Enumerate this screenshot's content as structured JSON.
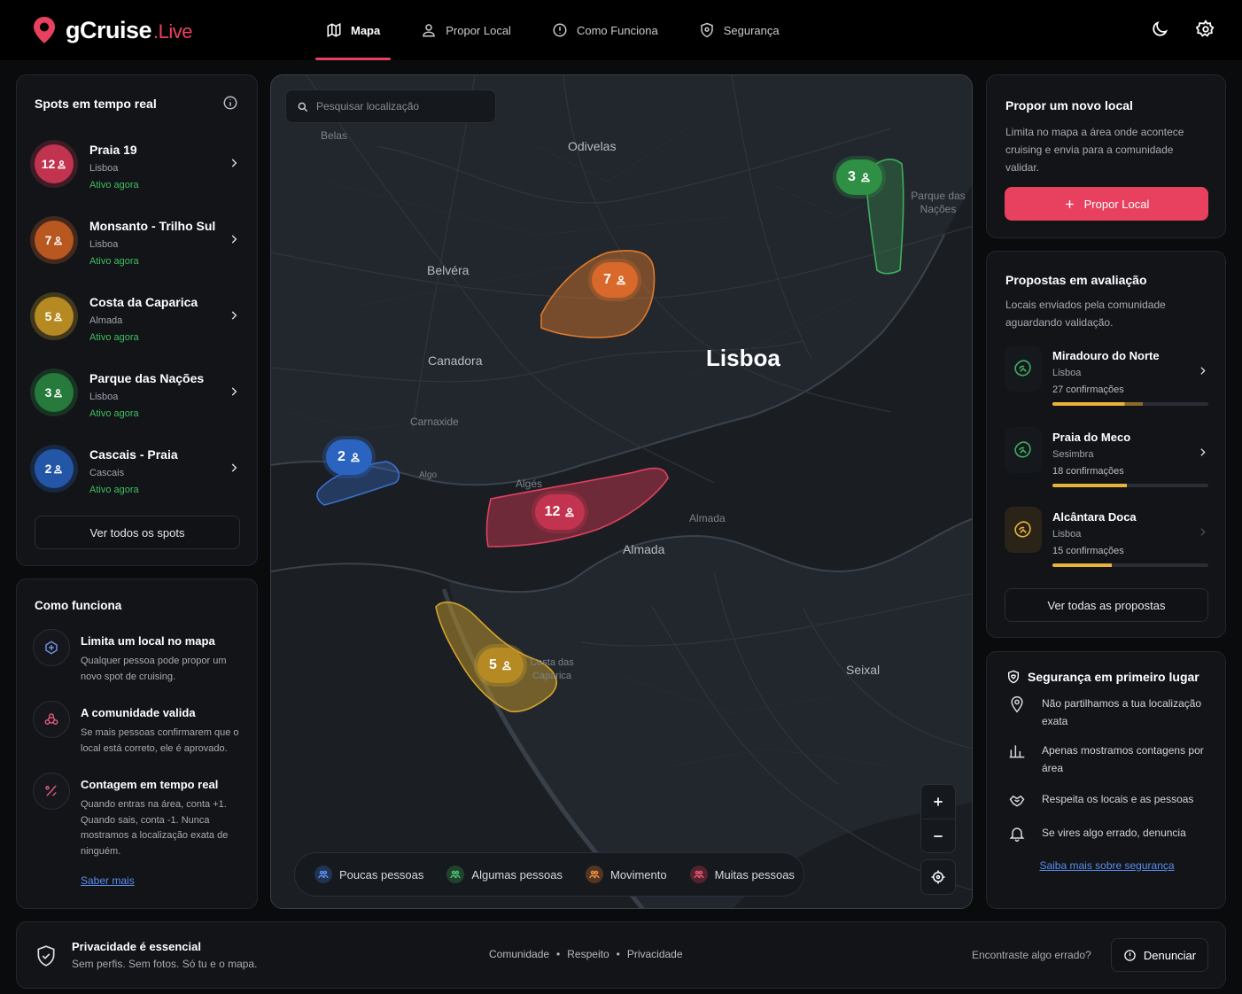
{
  "brand": {
    "name": "gCruise",
    "suffix": ".Live"
  },
  "nav": [
    {
      "label": "Mapa",
      "icon": "map-icon",
      "active": true
    },
    {
      "label": "Propor Local",
      "icon": "user-icon"
    },
    {
      "label": "Como Funciona",
      "icon": "info-icon"
    },
    {
      "label": "Segurança",
      "icon": "shield-icon"
    }
  ],
  "spots": {
    "title": "Spots em tempo real",
    "items": [
      {
        "count": "12",
        "name": "Praia 19",
        "city": "Lisboa",
        "status": "Ativo agora",
        "color": "#c2334f"
      },
      {
        "count": "7",
        "name": "Monsanto - Trilho Sul",
        "city": "Lisboa",
        "status": "Ativo agora",
        "color": "#d9692a"
      },
      {
        "count": "5",
        "name": "Costa da Caparica",
        "city": "Almada",
        "status": "Ativo agora",
        "color": "#d4a32c"
      },
      {
        "count": "3",
        "name": "Parque das Nações",
        "city": "Lisboa",
        "status": "Ativo agora",
        "color": "#2e8f45"
      },
      {
        "count": "2",
        "name": "Cascais - Praia",
        "city": "Cascais",
        "status": "Ativo agora",
        "color": "#2b64c0"
      }
    ],
    "view_all": "Ver todos os spots"
  },
  "how": {
    "title": "Como funciona",
    "steps": [
      {
        "title": "Limita um local no mapa",
        "desc": "Qualquer pessoa pode propor um novo spot de cruising."
      },
      {
        "title": "A comunidade valida",
        "desc": "Se mais pessoas confirmarem que o local está correto, ele é aprovado."
      },
      {
        "title": "Contagem em tempo real",
        "desc": "Quando entras na área, conta +1. Quando sais, conta -1. Nunca mostramos a localização exata de ninguém."
      }
    ],
    "link": "Saber mais"
  },
  "map": {
    "search_placeholder": "Pesquisar localização",
    "places": {
      "belas": "Belas",
      "odivelas": "Odivelas",
      "beloura": "Belvéra",
      "canadora": "Canadora",
      "carnaxide": "Carnaxide",
      "lisboa": "Lisboa",
      "parque": "Parque das Nações",
      "alges": "Algés",
      "almada_small": "Almada",
      "almada": "Almada",
      "seixal": "Seixal",
      "costa": "Costa das Caparica",
      "algo": "Algo"
    },
    "markers": {
      "m12": "12",
      "m7": "7",
      "m5": "5",
      "m3": "3",
      "m2": "2"
    },
    "legend": [
      {
        "label": "Poucas pessoas",
        "color": "#3b6fd1"
      },
      {
        "label": "Algumas pessoas",
        "color": "#3aa557"
      },
      {
        "label": "Movimento",
        "color": "#e07a2d"
      },
      {
        "label": "Muitas pessoas",
        "color": "#d83a55"
      }
    ]
  },
  "propose": {
    "title": "Propor um novo local",
    "desc": "Limita no mapa a área onde acontece cruising e envia para a comunidade validar.",
    "button": "Propor Local"
  },
  "proposals": {
    "title": "Propostas em avaliação",
    "desc": "Locais enviados pela comunidade aguardando validação.",
    "items": [
      {
        "name": "Miradouro do Norte",
        "city": "Lisboa",
        "conf": "27 confirmações",
        "progress": 0.58,
        "color": "#3aa557"
      },
      {
        "name": "Praia do Meco",
        "city": "Sesimbra",
        "conf": "18 confirmações",
        "progress": 0.48,
        "color": "#3aa557"
      },
      {
        "name": "Alcântara Doca",
        "city": "Lisboa",
        "conf": "15 confirmações",
        "progress": 0.38,
        "color": "#e8b23d"
      }
    ],
    "view_all": "Ver todas as propostas"
  },
  "safety": {
    "title": "Segurança em primeiro lugar",
    "items": [
      "Não partilhamos a tua localização exata",
      "Apenas mostramos contagens por área",
      "Respeita os locais e as pessoas",
      "Se vires algo errado, denuncia"
    ],
    "link": "Saiba mais sobre segurança"
  },
  "footer": {
    "title": "Privacidade é essencial",
    "subtitle": "Sem perfis. Sem fotos. Só tu e o mapa.",
    "links": [
      "Comunidade",
      "Respeito",
      "Privacidade"
    ],
    "question": "Encontraste algo errado?",
    "report": "Denunciar"
  }
}
